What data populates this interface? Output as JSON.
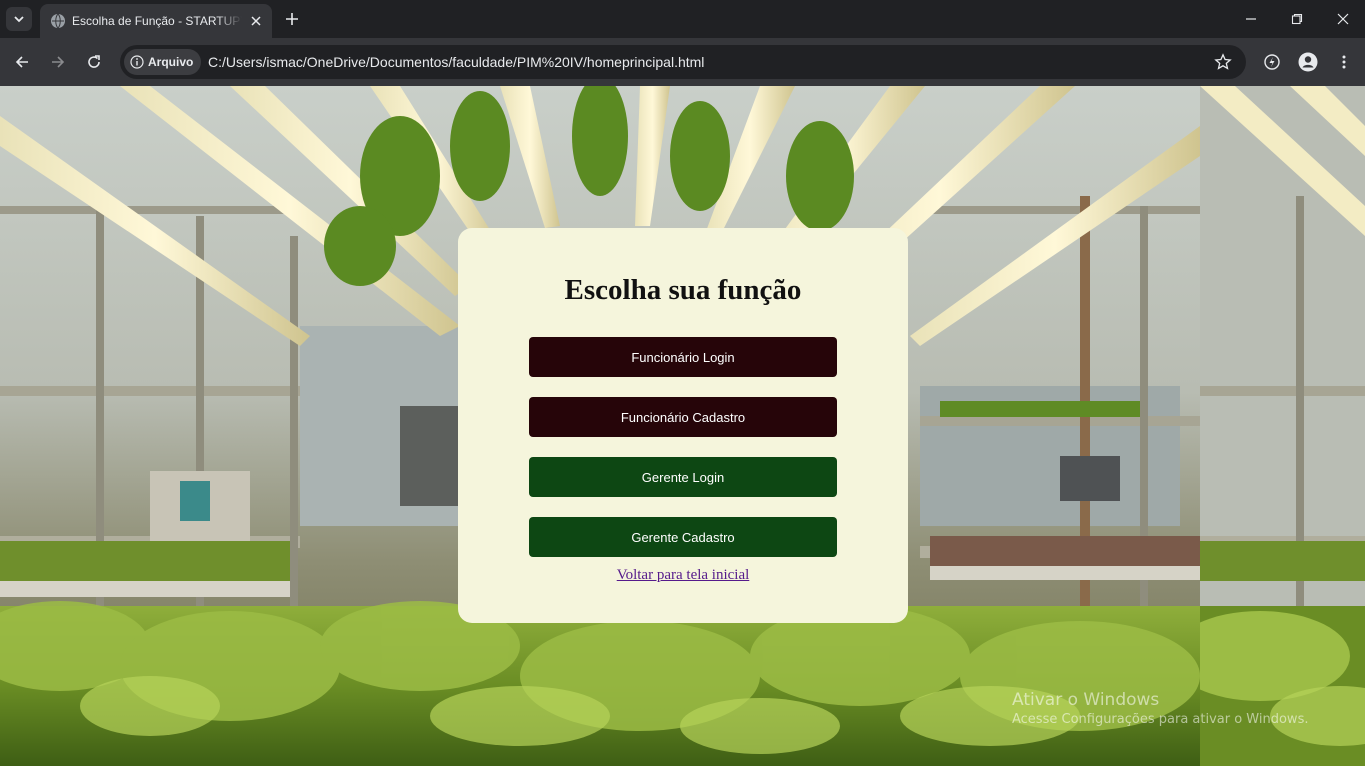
{
  "browser": {
    "tab_title": "Escolha de Função - STARTUPYAN",
    "security_chip": "Arquivo",
    "url": "C:/Users/ismac/OneDrive/Documentos/faculdade/PIM%20IV/homeprincipal.html"
  },
  "page": {
    "title": "Escolha sua função",
    "buttons": {
      "funcionario_login": "Funcionário Login",
      "funcionario_cadastro": "Funcionário Cadastro",
      "gerente_login": "Gerente Login",
      "gerente_cadastro": "Gerente Cadastro"
    },
    "back_link": "Voltar para tela inicial"
  },
  "watermark": {
    "title": "Ativar o Windows",
    "subtitle": "Acesse Configurações para ativar o Windows."
  },
  "colors": {
    "card_bg": "#f5f5dc",
    "dark_button": "#260509",
    "green_button": "#0d4713",
    "link": "#551a8b"
  }
}
